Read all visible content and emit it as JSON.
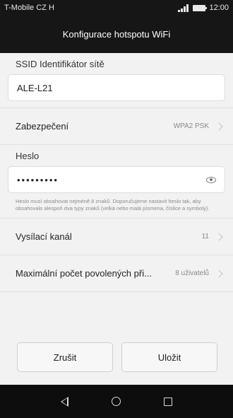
{
  "status_bar": {
    "carrier": "T-Mobile CZ",
    "time": "12:00",
    "sim_indicator": "H"
  },
  "header": {
    "title": "Konfigurace hotspotu WiFi"
  },
  "ssid": {
    "label": "SSID Identifikátor sítě",
    "value": "ALE-L21"
  },
  "security": {
    "label": "Zabezpečení",
    "value": "WPA2 PSK"
  },
  "password": {
    "label": "Heslo",
    "masked_value": "•••••••••",
    "hint": "Heslo musí obsahovat nejméně 8 znaků. Doporučujeme nastavit heslo tak, aby obsahovalo alespoň dva typy znaků (velká nebo malá písmena, číslice a symboly)."
  },
  "channel": {
    "label": "Vysílací kanál",
    "value": "11"
  },
  "max_users": {
    "label": "Maximální počet povolených při...",
    "value": "8 uživatelů"
  },
  "actions": {
    "cancel_label": "Zrušit",
    "save_label": "Uložit"
  },
  "icons": {
    "signal": "signal-icon",
    "battery": "battery-icon",
    "eye": "eye-icon",
    "chevron": "chevron-right-icon",
    "back": "back-icon",
    "home": "home-icon",
    "recent": "recent-apps-icon"
  },
  "colors": {
    "bar_background": "#161616",
    "page_background": "#f2f2f2",
    "muted_text": "#8a8a8a"
  }
}
